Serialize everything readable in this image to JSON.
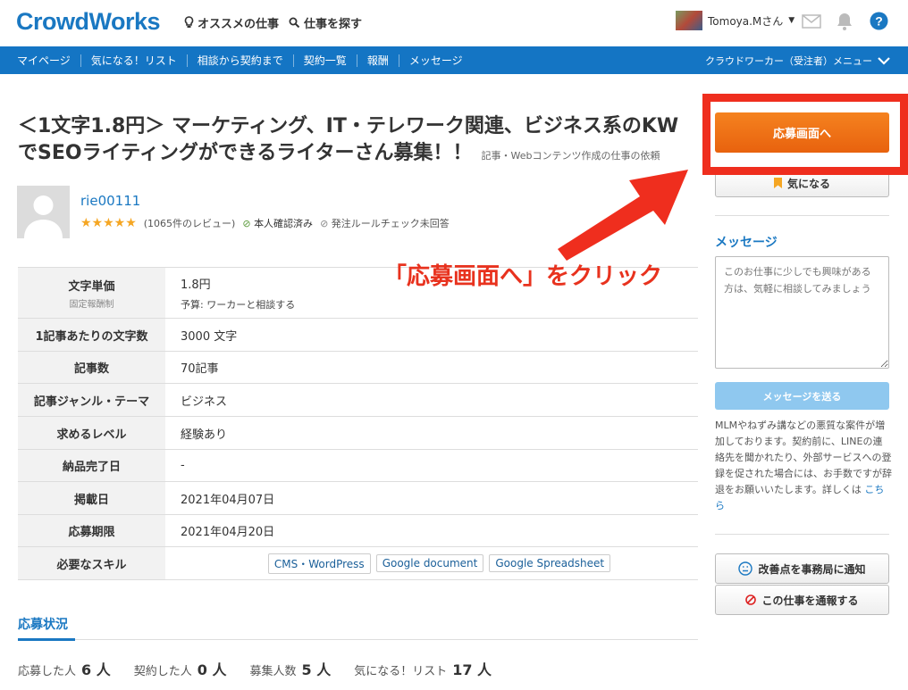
{
  "header": {
    "logo": "CrowdWorks",
    "nav_recommend": "オススメの仕事",
    "nav_search": "仕事を探す",
    "user_name": "Tomoya.Mさん"
  },
  "bluenav": {
    "items": [
      "マイページ",
      "気になる！リスト",
      "相談から契約まで",
      "契約一覧",
      "報酬",
      "メッセージ"
    ],
    "menu": "クラウドワーカー（受注者）メニュー"
  },
  "job": {
    "title": "＜1文字1.8円＞ マーケティング、IT・テレワーク関連、ビジネス系のKWでSEOライティングができるライターさん募集！！",
    "category": "記事・Webコンテンツ作成の仕事の依頼"
  },
  "client": {
    "name": "rie00111",
    "stars": "★★★★★",
    "reviews": "(1065件のレビュー)",
    "verified": "本人確認済み",
    "rule_check": "発注ルールチェック未回答"
  },
  "details": {
    "price_label": "文字単価",
    "price_sub": "固定報酬制",
    "price_value": "1.8円",
    "price_budget": "予算: ワーカーと相談する",
    "chars_label": "1記事あたりの文字数",
    "chars_value": "3000 文字",
    "count_label": "記事数",
    "count_value": "70記事",
    "genre_label": "記事ジャンル・テーマ",
    "genre_value": "ビジネス",
    "level_label": "求めるレベル",
    "level_value": "経験あり",
    "delivery_label": "納品完了日",
    "delivery_value": "-",
    "posted_label": "掲載日",
    "posted_value": "2021年04月07日",
    "deadline_label": "応募期限",
    "deadline_value": "2021年04月20日",
    "skills_label": "必要なスキル",
    "skills": [
      "CMS・WordPress",
      "Google document",
      "Google Spreadsheet"
    ]
  },
  "applications": {
    "title": "応募状況",
    "applied_label": "応募した人",
    "applied_value": "6 人",
    "contracted_label": "契約した人",
    "contracted_value": "0 人",
    "recruit_label": "募集人数",
    "recruit_value": "5 人",
    "fav_label": "気になる！リスト",
    "fav_value": "17 人"
  },
  "annotation": {
    "text": "「応募画面へ」をクリック",
    "color": "#e8321e"
  },
  "sidebar": {
    "apply": "応募画面へ",
    "favorite": "気になる",
    "message_title": "メッセージ",
    "message_placeholder": "このお仕事に少しでも興味がある方は、気軽に相談してみましょう",
    "send": "メッセージを送る",
    "warning": "MLMやねずみ講などの悪質な案件が増加しております。契約前に、LINEの連絡先を聞かれたり、外部サービスへの登録を促された場合には、お手数ですが辞退をお願いいたします。詳しくは",
    "warning_link": "こちら",
    "improve": "改善点を事務局に通知",
    "report": "この仕事を通報する"
  },
  "colors": {
    "brand": "#1a78c2",
    "nav": "#1475c4",
    "apply": "#f0761a",
    "highlight": "#ef2e1e"
  }
}
